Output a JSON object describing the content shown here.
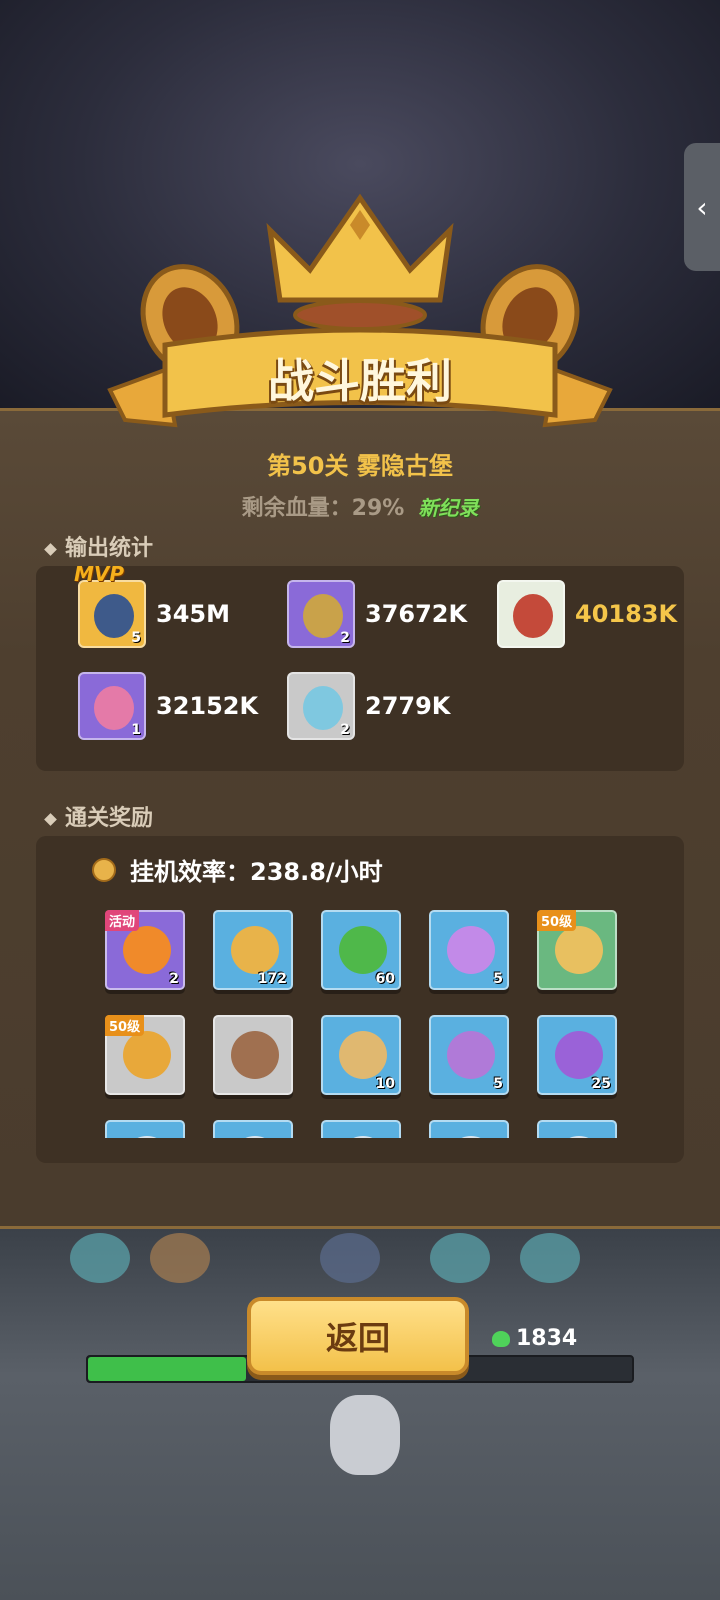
{
  "banner": {
    "title": "战斗胜利"
  },
  "stage": {
    "label": "第50关 雾隐古堡"
  },
  "result": {
    "hp_remaining": "剩余血量：29%",
    "new_record": "新纪录"
  },
  "damage_section": {
    "title": "输出统计",
    "mvp_label": "MVP",
    "heroes": [
      {
        "level": "5",
        "damage": "345M",
        "color": "#f0b840",
        "face": "#3e5a8a",
        "highlight": false
      },
      {
        "level": "2",
        "damage": "37672K",
        "color": "#8a6ad8",
        "face": "#c9a24a",
        "highlight": false
      },
      {
        "level": "",
        "damage": "40183K",
        "color": "#e8eee0",
        "face": "#c44a3a",
        "highlight": true
      },
      {
        "level": "1",
        "damage": "32152K",
        "color": "#8a6ad8",
        "face": "#e47aa8",
        "highlight": false
      },
      {
        "level": "2",
        "damage": "2779K",
        "color": "#c9c9c9",
        "face": "#7fc8e0",
        "highlight": false
      }
    ]
  },
  "reward_section": {
    "title": "通关奖励",
    "efficiency": "挂机效率：238.8/小时",
    "items": [
      {
        "name": "torch-icon",
        "count": "2",
        "tag": "活动",
        "bg": "#8a6ad8",
        "glyph": "#f08a2a"
      },
      {
        "name": "gold-coin-icon",
        "count": "172",
        "tag": "",
        "bg": "#5ab0e0",
        "glyph": "#e8b34a"
      },
      {
        "name": "exp-orb-icon",
        "count": "60",
        "tag": "",
        "bg": "#5ab0e0",
        "glyph": "#4fb84a"
      },
      {
        "name": "purple-crystal-icon",
        "count": "5",
        "tag": "",
        "bg": "#5ab0e0",
        "glyph": "#c28ae8"
      },
      {
        "name": "armor-icon",
        "count": "",
        "tag": "50级",
        "bg": "#6ab880",
        "glyph": "#e8c060"
      },
      {
        "name": "amulet-icon",
        "count": "",
        "tag": "50级",
        "bg": "#c9c9c9",
        "glyph": "#e8a83a"
      },
      {
        "name": "mask-icon",
        "count": "",
        "tag": "",
        "bg": "#c9c9c9",
        "glyph": "#a07050"
      },
      {
        "name": "bronze-emblem-icon",
        "count": "10",
        "tag": "",
        "bg": "#5ab0e0",
        "glyph": "#e0b870"
      },
      {
        "name": "purple-emblem-icon",
        "count": "5",
        "tag": "",
        "bg": "#5ab0e0",
        "glyph": "#b07ad8"
      },
      {
        "name": "mystery-orb-icon",
        "count": "25",
        "tag": "",
        "bg": "#5ab0e0",
        "glyph": "#9a62d8"
      },
      {
        "name": "scroll-icon",
        "count": "",
        "tag": "",
        "bg": "#5ab0e0",
        "glyph": "#d8e4ee"
      },
      {
        "name": "scroll-icon",
        "count": "",
        "tag": "",
        "bg": "#5ab0e0",
        "glyph": "#d8e4ee"
      },
      {
        "name": "scroll-icon",
        "count": "",
        "tag": "",
        "bg": "#5ab0e0",
        "glyph": "#d8e4ee"
      },
      {
        "name": "scroll-icon",
        "count": "",
        "tag": "",
        "bg": "#5ab0e0",
        "glyph": "#d8e4ee"
      },
      {
        "name": "scroll-icon",
        "count": "",
        "tag": "",
        "bg": "#5ab0e0",
        "glyph": "#d8e4ee"
      }
    ]
  },
  "actions": {
    "back_label": "返回"
  },
  "battle": {
    "hp_count": "1834",
    "hp_fraction": 0.29
  },
  "colors": {
    "gold": "#f2c24a",
    "new_record_green": "#7fe05a",
    "highlight_damage": "#f5c64a"
  }
}
